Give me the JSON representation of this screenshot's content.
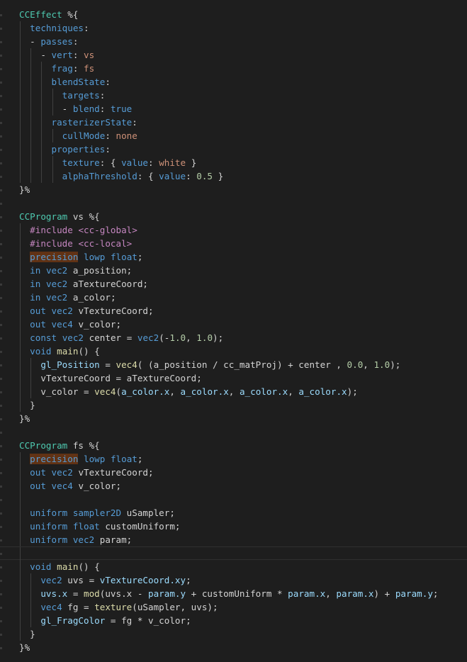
{
  "editor": {
    "theme": "dark",
    "colors": {
      "background": "#1e1e1e",
      "keyword": "#569cd6",
      "string": "#ce9178",
      "identifier": "#9cdcfe",
      "type": "#4ec9b0",
      "function": "#dcdcaa",
      "number": "#b5cea8",
      "preprocessor": "#c586c0",
      "highlight": "#613214"
    },
    "lines": [
      {
        "indent": 0,
        "tokens": [
          [
            "CCEffect",
            "ccfx"
          ],
          [
            " %{",
            "plain"
          ]
        ]
      },
      {
        "indent": 1,
        "tokens": [
          [
            "techniques",
            "yaml"
          ],
          [
            ":",
            "plain"
          ]
        ]
      },
      {
        "indent": 1,
        "tokens": [
          [
            "- ",
            "plain"
          ],
          [
            "passes",
            "yaml"
          ],
          [
            ":",
            "plain"
          ]
        ]
      },
      {
        "indent": 2,
        "tokens": [
          [
            "- ",
            "plain"
          ],
          [
            "vert",
            "yaml"
          ],
          [
            ": ",
            "plain"
          ],
          [
            "vs",
            "str"
          ]
        ]
      },
      {
        "indent": 3,
        "tokens": [
          [
            "frag",
            "yaml"
          ],
          [
            ": ",
            "plain"
          ],
          [
            "fs",
            "str"
          ]
        ]
      },
      {
        "indent": 3,
        "tokens": [
          [
            "blendState",
            "yaml"
          ],
          [
            ":",
            "plain"
          ]
        ]
      },
      {
        "indent": 4,
        "tokens": [
          [
            "targets",
            "yaml"
          ],
          [
            ":",
            "plain"
          ]
        ]
      },
      {
        "indent": 4,
        "tokens": [
          [
            "- ",
            "plain"
          ],
          [
            "blend",
            "yaml"
          ],
          [
            ": ",
            "plain"
          ],
          [
            "true",
            "key"
          ]
        ]
      },
      {
        "indent": 3,
        "tokens": [
          [
            "rasterizerState",
            "yaml"
          ],
          [
            ":",
            "plain"
          ]
        ]
      },
      {
        "indent": 4,
        "tokens": [
          [
            "cullMode",
            "yaml"
          ],
          [
            ": ",
            "plain"
          ],
          [
            "none",
            "str"
          ]
        ]
      },
      {
        "indent": 3,
        "tokens": [
          [
            "properties",
            "yaml"
          ],
          [
            ":",
            "plain"
          ]
        ]
      },
      {
        "indent": 4,
        "tokens": [
          [
            "texture",
            "yaml"
          ],
          [
            ": { ",
            "plain"
          ],
          [
            "value",
            "yaml"
          ],
          [
            ": ",
            "plain"
          ],
          [
            "white",
            "str"
          ],
          [
            " }",
            "plain"
          ]
        ]
      },
      {
        "indent": 4,
        "tokens": [
          [
            "alphaThreshold",
            "yaml"
          ],
          [
            ": { ",
            "plain"
          ],
          [
            "value",
            "yaml"
          ],
          [
            ": ",
            "plain"
          ],
          [
            "0.5",
            "num"
          ],
          [
            " }",
            "plain"
          ]
        ]
      },
      {
        "indent": 0,
        "tokens": [
          [
            "}%",
            "plain"
          ]
        ]
      },
      {
        "indent": 0,
        "tokens": []
      },
      {
        "indent": 0,
        "tokens": [
          [
            "CCProgram",
            "ccfx"
          ],
          [
            " vs %{",
            "plain"
          ]
        ]
      },
      {
        "indent": 1,
        "tokens": [
          [
            "#include",
            "pre"
          ],
          [
            " ",
            "plain"
          ],
          [
            "<cc-global>",
            "pre"
          ]
        ]
      },
      {
        "indent": 1,
        "tokens": [
          [
            "#include",
            "pre"
          ],
          [
            " ",
            "plain"
          ],
          [
            "<cc-local>",
            "pre"
          ]
        ]
      },
      {
        "indent": 1,
        "tokens": [
          [
            "precision",
            "prec"
          ],
          [
            " ",
            "plain"
          ],
          [
            "lowp",
            "kw"
          ],
          [
            " ",
            "plain"
          ],
          [
            "float",
            "kw"
          ],
          [
            ";",
            "plain"
          ]
        ]
      },
      {
        "indent": 1,
        "tokens": [
          [
            "in",
            "kw"
          ],
          [
            " ",
            "plain"
          ],
          [
            "vec2",
            "kw"
          ],
          [
            " a_position;",
            "plain"
          ]
        ]
      },
      {
        "indent": 1,
        "tokens": [
          [
            "in",
            "kw"
          ],
          [
            " ",
            "plain"
          ],
          [
            "vec2",
            "kw"
          ],
          [
            " aTextureCoord;",
            "plain"
          ]
        ]
      },
      {
        "indent": 1,
        "tokens": [
          [
            "in",
            "kw"
          ],
          [
            " ",
            "plain"
          ],
          [
            "vec2",
            "kw"
          ],
          [
            " a_color;",
            "plain"
          ]
        ]
      },
      {
        "indent": 1,
        "tokens": [
          [
            "out",
            "kw"
          ],
          [
            " ",
            "plain"
          ],
          [
            "vec2",
            "kw"
          ],
          [
            " vTextureCoord;",
            "plain"
          ]
        ]
      },
      {
        "indent": 1,
        "tokens": [
          [
            "out",
            "kw"
          ],
          [
            " ",
            "plain"
          ],
          [
            "vec4",
            "kw"
          ],
          [
            " v_color;",
            "plain"
          ]
        ]
      },
      {
        "indent": 1,
        "tokens": [
          [
            "const",
            "kw"
          ],
          [
            " ",
            "plain"
          ],
          [
            "vec2",
            "kw"
          ],
          [
            " center = ",
            "plain"
          ],
          [
            "vec2",
            "kw"
          ],
          [
            "(-",
            "plain"
          ],
          [
            "1.0",
            "num"
          ],
          [
            ", ",
            "plain"
          ],
          [
            "1.0",
            "num"
          ],
          [
            ");",
            "plain"
          ]
        ]
      },
      {
        "indent": 1,
        "tokens": [
          [
            "void",
            "kw"
          ],
          [
            " ",
            "plain"
          ],
          [
            "main",
            "func"
          ],
          [
            "() {",
            "plain"
          ]
        ]
      },
      {
        "indent": 2,
        "tokens": [
          [
            "gl_Position",
            "ident"
          ],
          [
            " = ",
            "plain"
          ],
          [
            "vec4",
            "func"
          ],
          [
            "( (a_position / cc_matProj) + center , ",
            "plain"
          ],
          [
            "0.0",
            "num"
          ],
          [
            ", ",
            "plain"
          ],
          [
            "1.0",
            "num"
          ],
          [
            ");",
            "plain"
          ]
        ]
      },
      {
        "indent": 2,
        "tokens": [
          [
            "vTextureCoord = aTextureCoord;",
            "plain"
          ]
        ]
      },
      {
        "indent": 2,
        "tokens": [
          [
            "v_color = ",
            "plain"
          ],
          [
            "vec4",
            "func"
          ],
          [
            "(",
            "plain"
          ],
          [
            "a_color.x",
            "ident"
          ],
          [
            ", ",
            "plain"
          ],
          [
            "a_color.x",
            "ident"
          ],
          [
            ", ",
            "plain"
          ],
          [
            "a_color.x",
            "ident"
          ],
          [
            ", ",
            "plain"
          ],
          [
            "a_color.x",
            "ident"
          ],
          [
            ");",
            "plain"
          ]
        ]
      },
      {
        "indent": 1,
        "tokens": [
          [
            "}",
            "plain"
          ]
        ]
      },
      {
        "indent": 0,
        "tokens": [
          [
            "}%",
            "plain"
          ]
        ]
      },
      {
        "indent": 0,
        "tokens": []
      },
      {
        "indent": 0,
        "tokens": [
          [
            "CCProgram",
            "ccfx"
          ],
          [
            " fs %{",
            "plain"
          ]
        ]
      },
      {
        "indent": 1,
        "tokens": [
          [
            "precision",
            "prec"
          ],
          [
            " ",
            "plain"
          ],
          [
            "lowp",
            "kw"
          ],
          [
            " ",
            "plain"
          ],
          [
            "float",
            "kw"
          ],
          [
            ";",
            "plain"
          ]
        ]
      },
      {
        "indent": 1,
        "tokens": [
          [
            "out",
            "kw"
          ],
          [
            " ",
            "plain"
          ],
          [
            "vec2",
            "kw"
          ],
          [
            " vTextureCoord;",
            "plain"
          ]
        ]
      },
      {
        "indent": 1,
        "tokens": [
          [
            "out",
            "kw"
          ],
          [
            " ",
            "plain"
          ],
          [
            "vec4",
            "kw"
          ],
          [
            " v_color;",
            "plain"
          ]
        ]
      },
      {
        "indent": 1,
        "tokens": []
      },
      {
        "indent": 1,
        "tokens": [
          [
            "uniform",
            "kw"
          ],
          [
            " ",
            "plain"
          ],
          [
            "sampler2D",
            "kw"
          ],
          [
            " uSampler;",
            "plain"
          ]
        ]
      },
      {
        "indent": 1,
        "tokens": [
          [
            "uniform",
            "kw"
          ],
          [
            " ",
            "plain"
          ],
          [
            "float",
            "kw"
          ],
          [
            " customUniform;",
            "plain"
          ]
        ]
      },
      {
        "indent": 1,
        "tokens": [
          [
            "uniform",
            "kw"
          ],
          [
            " ",
            "plain"
          ],
          [
            "vec2",
            "kw"
          ],
          [
            " param;",
            "plain"
          ]
        ]
      },
      {
        "indent": 1,
        "tokens": [],
        "current": true
      },
      {
        "indent": 1,
        "tokens": [
          [
            "void",
            "kw"
          ],
          [
            " ",
            "plain"
          ],
          [
            "main",
            "func"
          ],
          [
            "() {",
            "plain"
          ]
        ]
      },
      {
        "indent": 2,
        "tokens": [
          [
            "vec2",
            "kw"
          ],
          [
            " uvs = ",
            "plain"
          ],
          [
            "vTextureCoord.xy",
            "ident"
          ],
          [
            ";",
            "plain"
          ]
        ]
      },
      {
        "indent": 2,
        "tokens": [
          [
            "uvs.x",
            "ident"
          ],
          [
            " = ",
            "plain"
          ],
          [
            "mod",
            "func"
          ],
          [
            "(uvs.x - ",
            "plain"
          ],
          [
            "param.y",
            "ident"
          ],
          [
            " + customUniform * ",
            "plain"
          ],
          [
            "param.x",
            "ident"
          ],
          [
            ", ",
            "plain"
          ],
          [
            "param.x",
            "ident"
          ],
          [
            ") + ",
            "plain"
          ],
          [
            "param.y",
            "ident"
          ],
          [
            ";",
            "plain"
          ]
        ]
      },
      {
        "indent": 2,
        "tokens": [
          [
            "vec4",
            "kw"
          ],
          [
            " fg = ",
            "plain"
          ],
          [
            "texture",
            "func"
          ],
          [
            "(uSampler, uvs);",
            "plain"
          ]
        ]
      },
      {
        "indent": 2,
        "tokens": [
          [
            "gl_FragColor",
            "ident"
          ],
          [
            " = fg * v_color;",
            "plain"
          ]
        ]
      },
      {
        "indent": 1,
        "tokens": [
          [
            "}",
            "plain"
          ]
        ]
      },
      {
        "indent": 0,
        "tokens": [
          [
            "}%",
            "plain"
          ]
        ]
      }
    ]
  }
}
